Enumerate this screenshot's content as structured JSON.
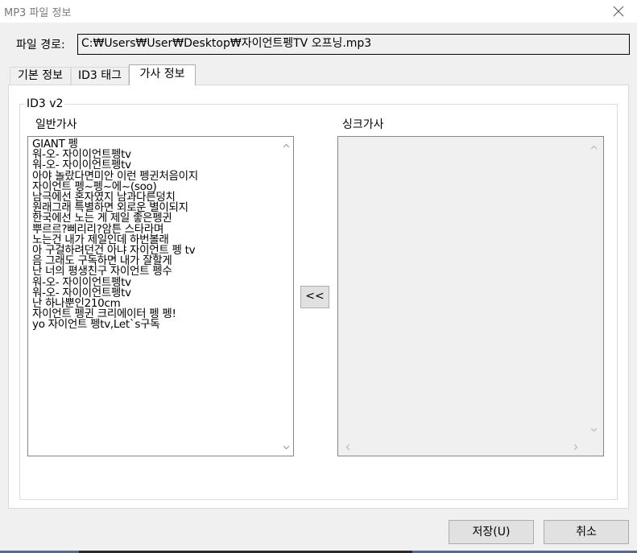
{
  "window": {
    "title": "MP3 파일 정보",
    "close_glyph": "✕"
  },
  "file_path": {
    "label": "파일 경로:",
    "value": "C:₩Users₩User₩Desktop₩자이언트펭TV 오프닝.mp3"
  },
  "tabs": [
    {
      "label": "기본 정보",
      "active": false
    },
    {
      "label": "ID3 태그",
      "active": false
    },
    {
      "label": "가사 정보",
      "active": true
    }
  ],
  "group": {
    "label": "ID3 v2"
  },
  "lyrics": {
    "label": "일반가사",
    "lines": [
      "GIANT 펭",
      "워-오- 자이이언트펭tv",
      "워-오- 자이이언트펭tv",
      "아야 놀랐다면미안 이런 펭귄처음이지",
      "자이언트 펭~펭~에~(soo)",
      "남극에선 혼자였지 남과다른덩치",
      "원래그래 특별하면 외로운 별이되지",
      "한국에선 노는 게 제일 좋은펭귄",
      "뿌르르?삐리리?암튼 스타라며",
      "노는건 내가 제일인데 하번볼래",
      "아 구걸하려던건 아냐 자이언트 펭 tv",
      "음 그래도 구독하면 내가 잘할게",
      "난 너의 평생친구 자이언트 펭수",
      "워-오- 자이이언트펭tv",
      "워-오- 자이이언트펭tv",
      "난 하나뿐인210cm",
      "자이언트 펭귄 크리에이터 펭 펭!",
      "yo 자이언트 펭tv,Let`s구독"
    ]
  },
  "sync_lyrics": {
    "label": "싱크가사"
  },
  "transfer_button": {
    "label": "<<"
  },
  "buttons": {
    "save": "저장(U)",
    "cancel": "취소"
  }
}
